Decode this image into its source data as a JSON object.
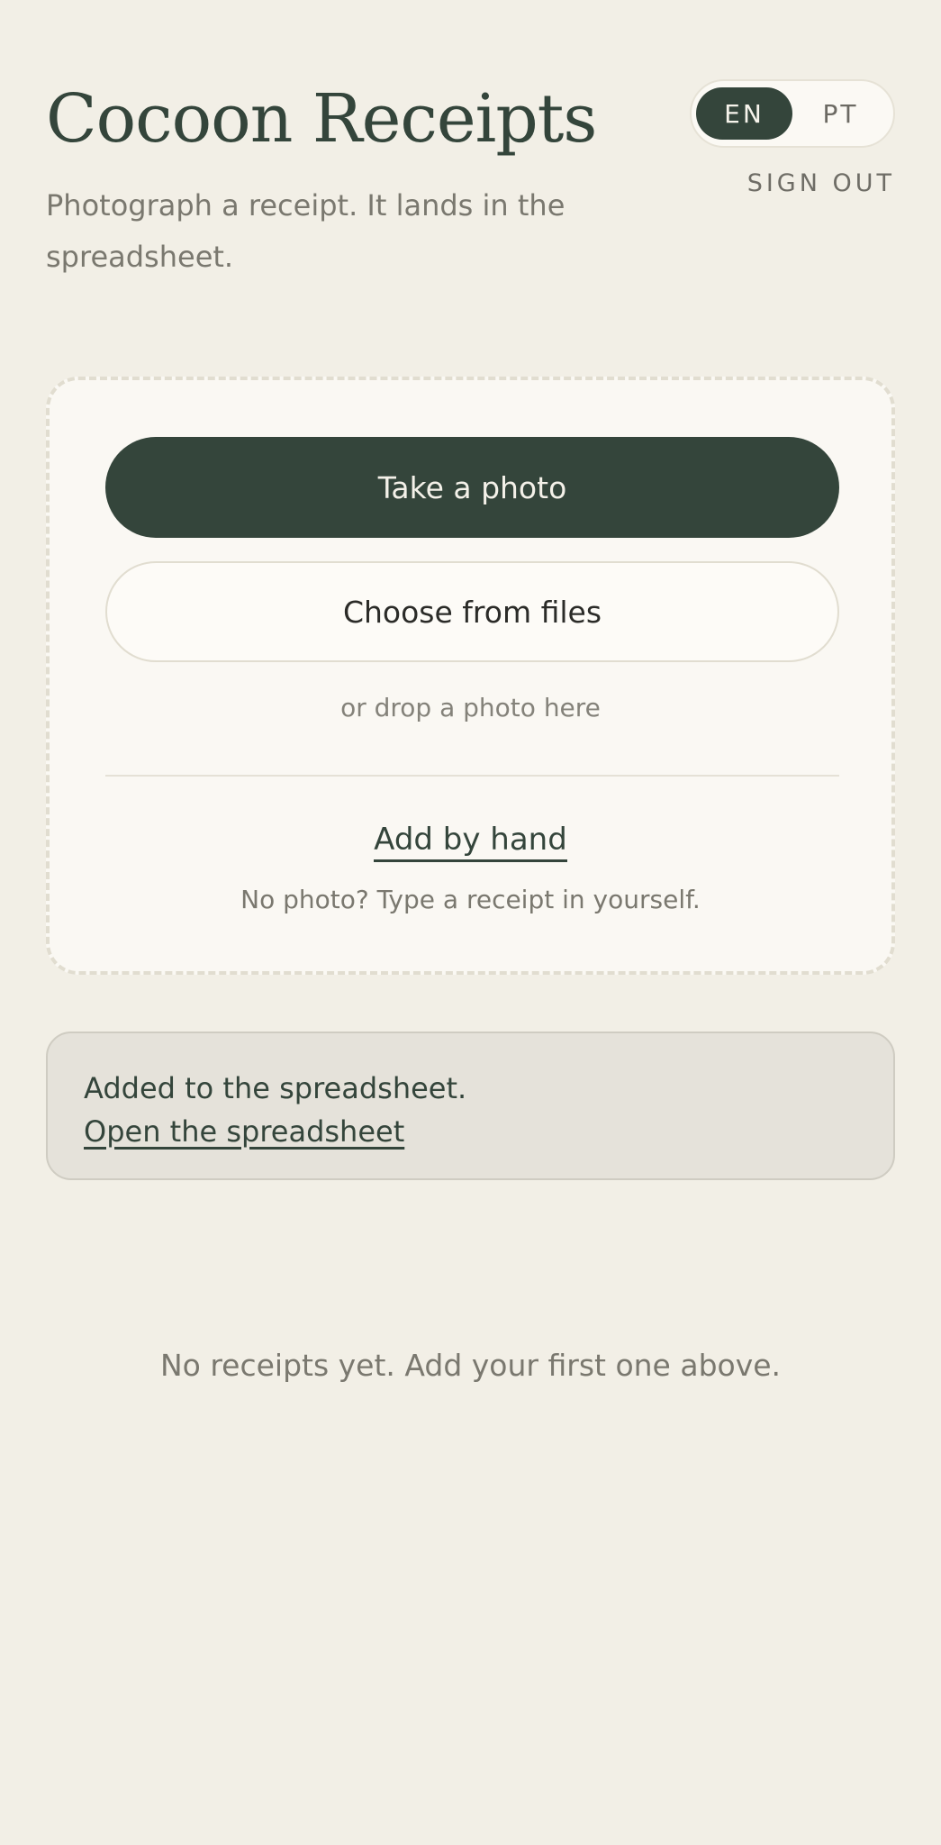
{
  "header": {
    "title": "Cocoon Receipts",
    "tagline": "Photograph a receipt. It lands in the spreadsheet.",
    "languages": [
      {
        "label": "EN",
        "active": true
      },
      {
        "label": "PT",
        "active": false
      }
    ],
    "sign_out_label": "SIGN OUT"
  },
  "upload": {
    "take_photo_label": "Take a photo",
    "choose_files_label": "Choose from files",
    "drop_hint": "or drop a photo here",
    "add_by_hand_label": "Add by hand",
    "add_by_hand_hint": "No photo? Type a receipt in yourself."
  },
  "notice": {
    "message": "Added to the spreadsheet.",
    "link_label": "Open the spreadsheet"
  },
  "receipts": {
    "empty_message": "No receipts yet. Add your first one above."
  },
  "colors": {
    "accent": "#34453b",
    "background": "#f2efe6",
    "card": "#faf8f3",
    "notice_background": "#e5e2da"
  }
}
